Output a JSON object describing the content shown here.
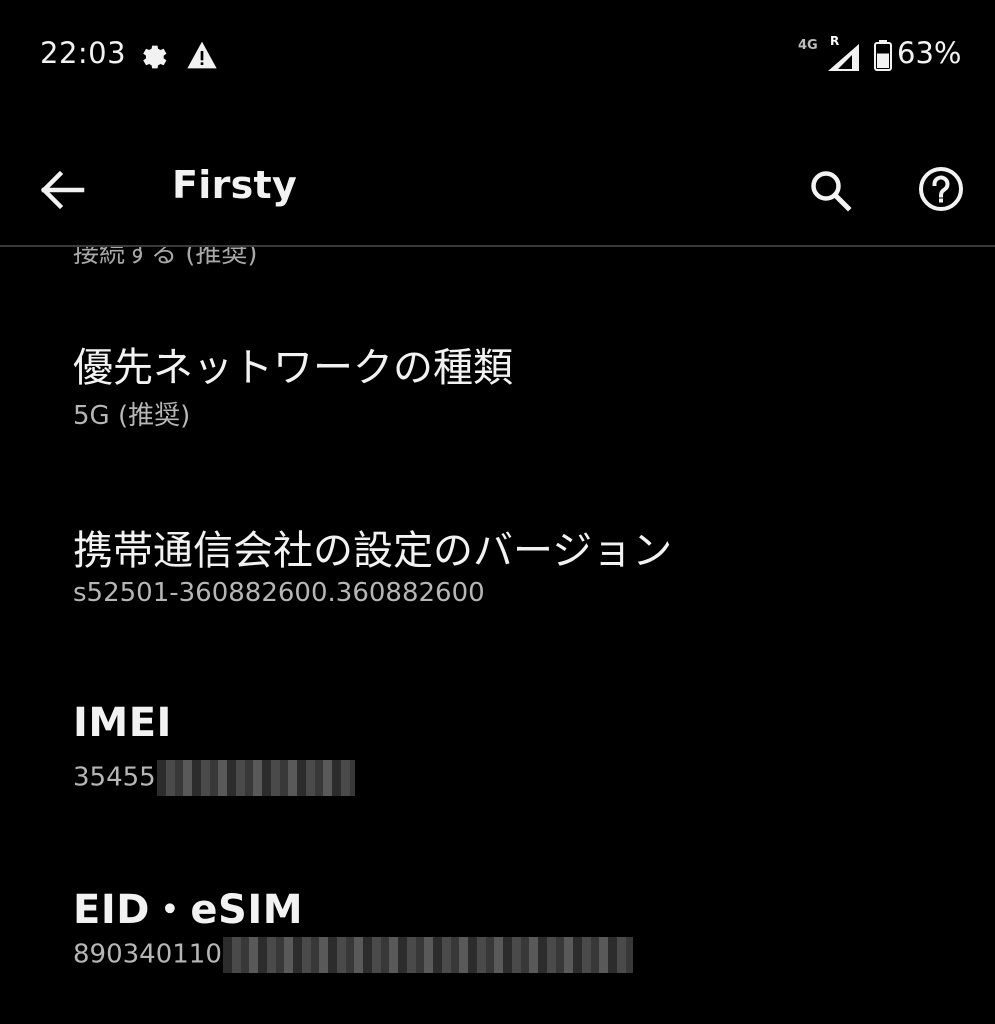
{
  "status_bar": {
    "time": "22:03",
    "left_icons": [
      "settings-icon",
      "warning-icon"
    ],
    "network_type": "4G",
    "roaming_indicator": "R",
    "battery_percent": "63%",
    "battery_level": 0.63
  },
  "app_bar": {
    "title": "Firsty",
    "back_icon": "arrow-back-icon",
    "search_icon": "search-icon",
    "help_icon": "help-icon"
  },
  "settings": {
    "partial_summary": "接続する (推奨)",
    "items": [
      {
        "title": "優先ネットワークの種類",
        "summary": "5G (推奨)"
      },
      {
        "title": "携帯通信会社の設定のバージョン",
        "summary": "s52501-360882600.360882600"
      },
      {
        "title": "IMEI",
        "summary": "35455"
      },
      {
        "title": "EID・eSIM",
        "summary": "890340110"
      }
    ]
  }
}
